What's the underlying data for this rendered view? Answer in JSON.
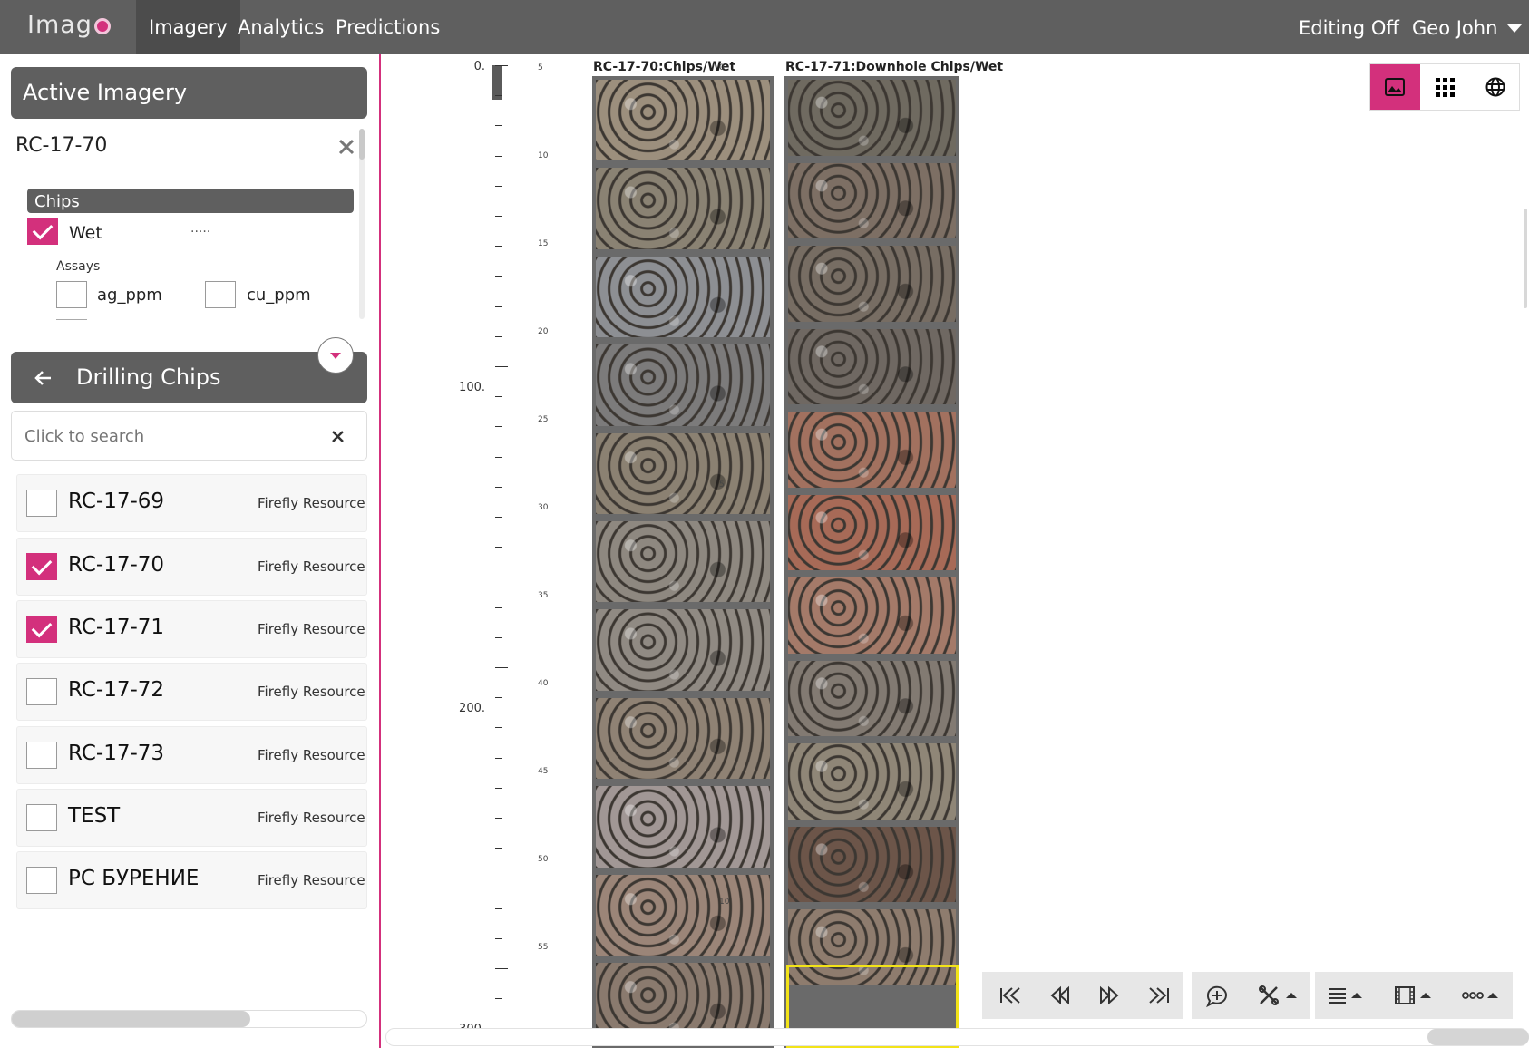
{
  "app": {
    "logo": "Imag",
    "brand_color": "#d3307c"
  },
  "nav": {
    "tabs": [
      {
        "label": "Imagery"
      },
      {
        "label": "Analytics"
      },
      {
        "label": "Predictions"
      }
    ],
    "editing": "Editing Off",
    "user": "Geo John"
  },
  "active_imagery": {
    "title": "Active Imagery",
    "hole": "RC-17-70",
    "group": "Chips",
    "type_label": "Wet",
    "line_style": ".....",
    "assays_label": "Assays",
    "assays": [
      "ag_ppm",
      "cu_ppm"
    ]
  },
  "drilling_chips": {
    "title": "Drilling Chips",
    "search_placeholder": "Click to search",
    "items": [
      {
        "name": "RC-17-69",
        "org": "Firefly Resource De",
        "checked": false
      },
      {
        "name": "RC-17-70",
        "org": "Firefly Resource De",
        "checked": true
      },
      {
        "name": "RC-17-71",
        "org": "Firefly Resource De",
        "checked": true
      },
      {
        "name": "RC-17-72",
        "org": "Firefly Resource De",
        "checked": false
      },
      {
        "name": "RC-17-73",
        "org": "Firefly Resource De",
        "checked": false
      },
      {
        "name": "TEST",
        "org": "Firefly Resource De",
        "checked": false
      },
      {
        "name": "РС БУРЕНИЕ",
        "org": "Firefly Resource De",
        "checked": false
      }
    ]
  },
  "viewer": {
    "col1_title": "RC-17-70:Chips/Wet",
    "col2_title": "RC-17-71:Downhole Chips/Wet",
    "depth_labels": [
      "0.",
      "100.",
      "200.",
      "300."
    ],
    "col1_ticks": [
      "5",
      "10",
      "15",
      "20",
      "25",
      "30",
      "35",
      "40",
      "45",
      "50",
      "55"
    ],
    "col2_ticks": [
      "0",
      "5",
      "10"
    ]
  }
}
